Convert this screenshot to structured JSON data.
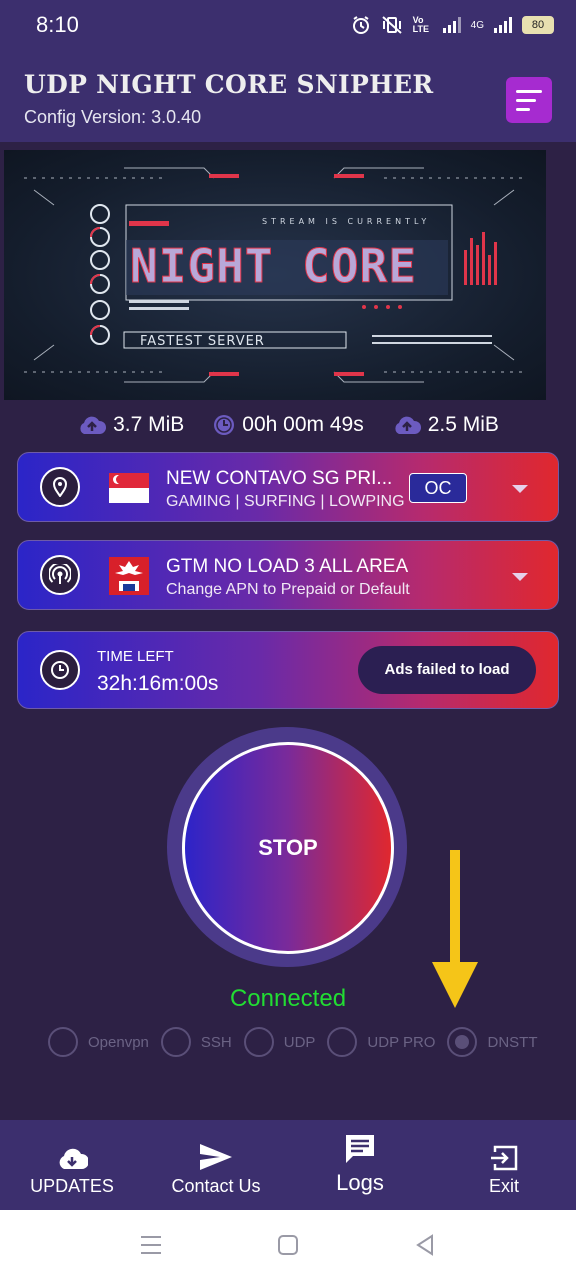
{
  "status_bar": {
    "time": "8:10",
    "network": "4G",
    "volte": "Vo LTE",
    "battery": "80"
  },
  "header": {
    "title": "UDP NIGHT CORE SNIPHER",
    "subtitle": "Config Version: 3.0.40",
    "menu_icon": "menu-icon"
  },
  "banner": {
    "tagline": "STREAM IS CURRENTLY",
    "logo_text": "NIGHT CORE",
    "caption": "FASTEST SERVER"
  },
  "stats": {
    "upload": "3.7 MiB",
    "duration": "00h 00m 49s",
    "download": "2.5 MiB"
  },
  "server": {
    "name": "NEW CONTAVO SG PRI...",
    "tags": "GAMING | SURFING | LOWPING",
    "badge": "OC"
  },
  "network_config": {
    "name": "GTM NO LOAD 3 ALL AREA",
    "hint": "Change APN to Prepaid or Default"
  },
  "timer": {
    "label": "TIME LEFT",
    "value": "32h:16m:00s",
    "ads_button": "Ads failed to load"
  },
  "connection": {
    "button": "STOP",
    "status": "Connected",
    "status_color": "#22dd33"
  },
  "protocols": [
    {
      "label": "Openvpn",
      "selected": false
    },
    {
      "label": "SSH",
      "selected": false
    },
    {
      "label": "UDP",
      "selected": false
    },
    {
      "label": "UDP PRO",
      "selected": false
    },
    {
      "label": "DNSTT",
      "selected": true
    }
  ],
  "bottom_nav": [
    {
      "label": "UPDATES",
      "icon": "cloud-download-icon"
    },
    {
      "label": "Contact Us",
      "icon": "send-icon"
    },
    {
      "label": "Logs",
      "icon": "chat-icon"
    },
    {
      "label": "Exit",
      "icon": "exit-icon"
    }
  ],
  "colors": {
    "bar": "#3c2f6e",
    "background": "#2d2145",
    "accent_purple": "#a62bd0",
    "gradient_start": "#2b25c8",
    "gradient_end": "#e0282e",
    "arrow": "#f5c518"
  }
}
